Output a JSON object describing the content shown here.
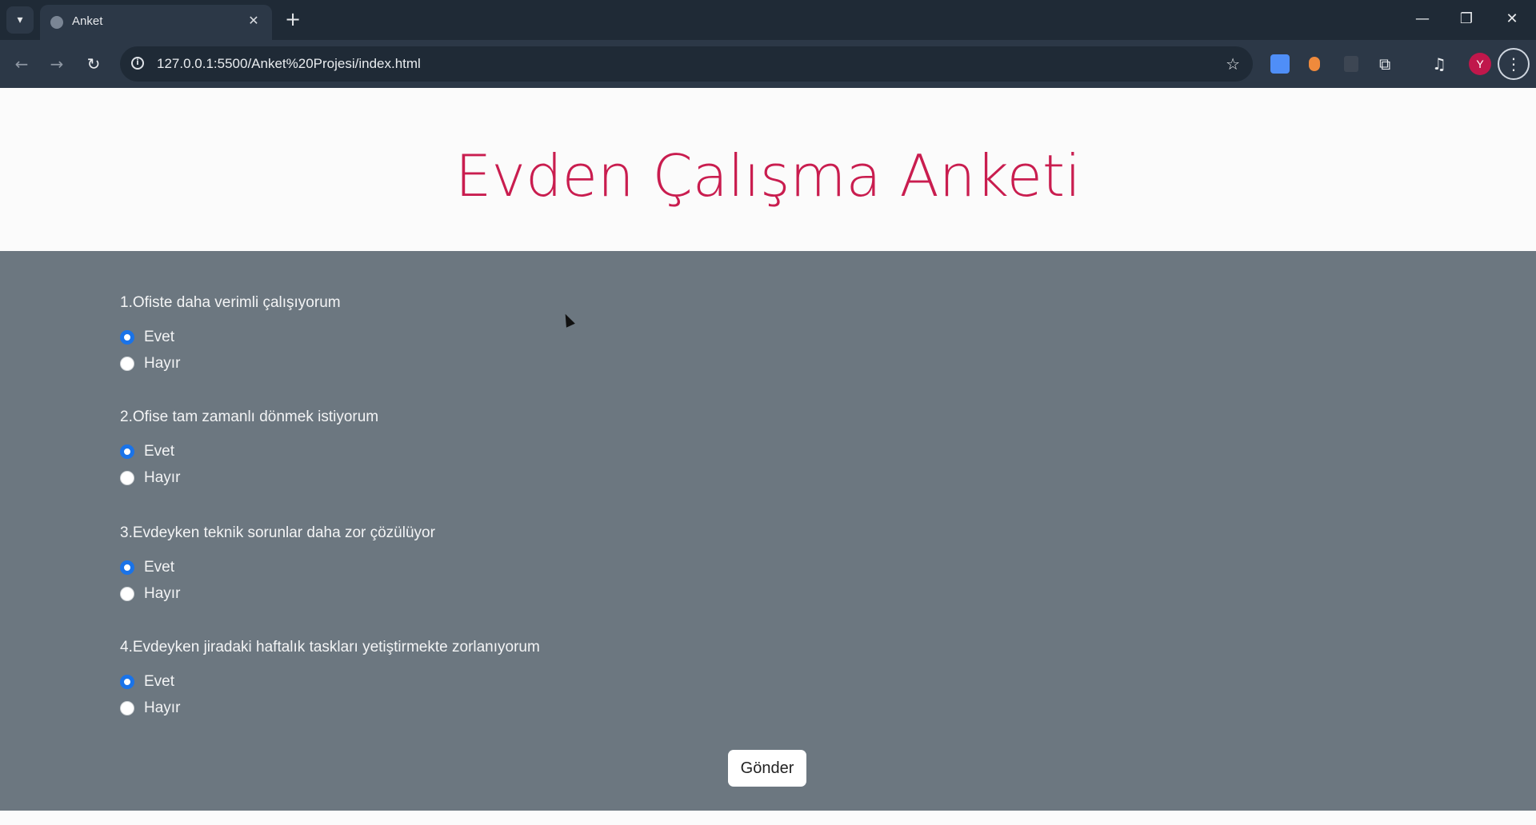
{
  "browser": {
    "tab_title": "Anket",
    "url": "127.0.0.1:5500/Anket%20Projesi/index.html",
    "avatar_letter": "Y"
  },
  "page": {
    "title": "Evden Çalışma Anketi",
    "questions": [
      {
        "text": "1.Ofiste daha verimli çalışıyorum",
        "options": [
          "Evet",
          "Hayır"
        ],
        "selected": "Evet"
      },
      {
        "text": "2.Ofise tam zamanlı dönmek istiyorum",
        "options": [
          "Evet",
          "Hayır"
        ],
        "selected": "Evet"
      },
      {
        "text": "3.Evdeyken teknik sorunlar daha zor çözülüyor",
        "options": [
          "Evet",
          "Hayır"
        ],
        "selected": "Evet"
      },
      {
        "text": "4.Evdeyken jiradaki haftalık taskları yetiştirmekte zorlanıyorum",
        "options": [
          "Evet",
          "Hayır"
        ],
        "selected": "Evet"
      }
    ],
    "submit_label": "Gönder"
  },
  "colors": {
    "title": "#c91d4f",
    "form_bg": "#6c7780",
    "radio_checked": "#1a73e8"
  }
}
